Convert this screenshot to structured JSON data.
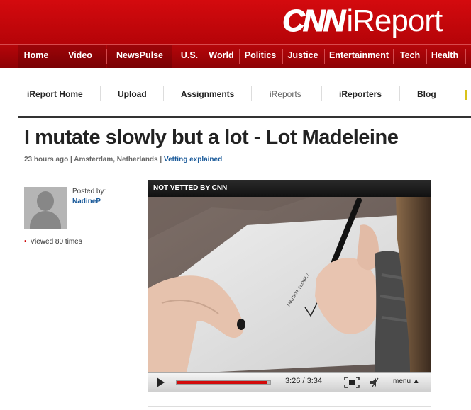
{
  "logo": {
    "cnn": "CNN",
    "ireport": "iReport"
  },
  "nav": {
    "items": [
      {
        "label": "Home",
        "highlight": true
      },
      {
        "label": "Video",
        "highlight": true
      },
      {
        "label": "NewsPulse",
        "highlight": true
      },
      {
        "label": "U.S.",
        "highlight": false
      },
      {
        "label": "World",
        "highlight": false
      },
      {
        "label": "Politics",
        "highlight": false
      },
      {
        "label": "Justice",
        "highlight": false
      },
      {
        "label": "Entertainment",
        "highlight": false
      },
      {
        "label": "Tech",
        "highlight": false
      },
      {
        "label": "Health",
        "highlight": false
      }
    ]
  },
  "subnav": {
    "items": [
      {
        "label": "iReport Home",
        "active": true
      },
      {
        "label": "Upload",
        "active": true
      },
      {
        "label": "Assignments",
        "active": true
      },
      {
        "label": "iReports",
        "active": false
      },
      {
        "label": "iReporters",
        "active": true
      },
      {
        "label": "Blog",
        "active": true
      }
    ]
  },
  "story": {
    "title": "I mutate slowly but a lot - Lot Madeleine",
    "time_ago": "23 hours ago",
    "location": "Amsterdam, Netherlands",
    "vetting_link": "Vetting explained"
  },
  "sidebar": {
    "posted_by_label": "Posted by:",
    "poster_name": "NadineP",
    "viewed_bullet": "•",
    "viewed_text": "Viewed 80 times"
  },
  "player": {
    "status_label": "NOT VETTED BY CNN",
    "time_display": "3:26 / 3:34",
    "progress_fraction": 0.96,
    "menu_label": "menu"
  },
  "colors": {
    "brand_red": "#c8050a",
    "link_blue": "#1a5a9a",
    "progress_red": "#d30b0b"
  }
}
